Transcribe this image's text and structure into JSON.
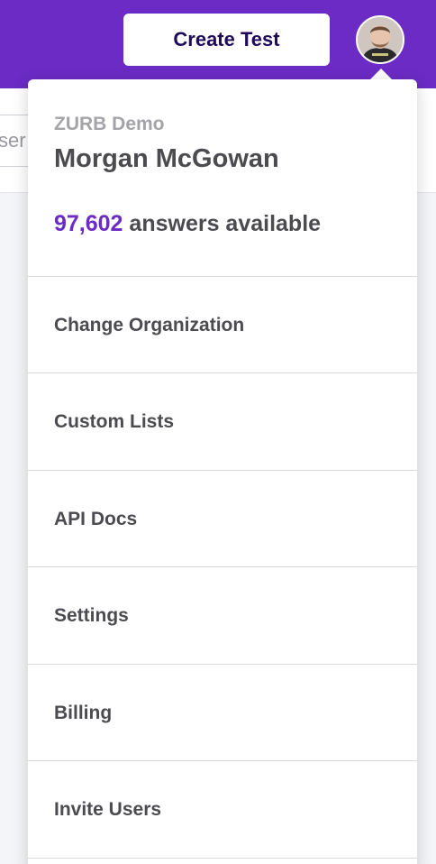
{
  "header": {
    "create_button_label": "Create Test",
    "brand_color": "#6b2bc4"
  },
  "search": {
    "partial_text": "ser"
  },
  "account_menu": {
    "organization": "ZURB Demo",
    "user_name": "Morgan McGowan",
    "answers_count": "97,602",
    "answers_label": "answers available",
    "items": [
      {
        "label": "Change Organization"
      },
      {
        "label": "Custom Lists"
      },
      {
        "label": "API Docs"
      },
      {
        "label": "Settings"
      },
      {
        "label": "Billing"
      },
      {
        "label": "Invite Users"
      }
    ]
  }
}
